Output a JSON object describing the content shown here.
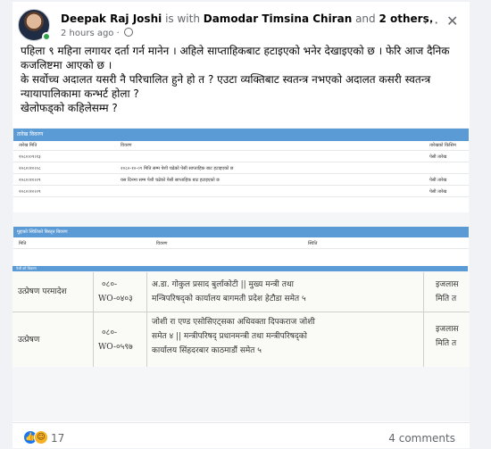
{
  "post": {
    "author": "Deepak Raj Joshi",
    "is_with_text": "is with",
    "tagged": "Damodar Timsina Chiran",
    "and_text": "and",
    "others": "2 others.",
    "time": "2 hours ago",
    "lines": [
      "पहिला ९ महिना लगायर दर्ता गर्न मानेन । अहिले साप्ताहिकबाट हटाइएको भनेर देखाइएको छ । फेरि आज दैनिक",
      "कजलिष्टमा आएको छ ।",
      "के सर्वोच्च अदालत यसरी नै परिचालित हुने हो त ? एउटा व्यक्तिबाट स्वतन्त्र नभएको अदालत कसरी स्वतन्त्र",
      "न्यायापालिकामा कन्भर्ट होला ?",
      "खेलोफड्को कहिलेसम्म ?"
    ]
  },
  "doc": {
    "section1_title": "तारेख विवरण",
    "headers1": [
      "तारेख मिति",
      "विवरण",
      "तारेखको किसिम"
    ],
    "rows1": [
      [
        "२०८०।०९।१३",
        "",
        "पेसी तारेख"
      ],
      [
        "२०८०।१०।०८",
        "२०८०-१०-०९ मिति सम्म पेशी चढेको पेसी साप्ताहिक बाट हटाइएको छ",
        ""
      ],
      [
        "२०८०।१०।०९",
        "यस दिनमा सम्म पेशी चढेको पेसी साप्ताहिक बाट हटाइएको छ",
        "पेसी तारेख"
      ],
      [
        "२०८०।१०।०९",
        "",
        "पेसी तारेख"
      ]
    ],
    "section2_title": "मुद्दाको स्थितिको बिस्तृत बिवरण",
    "headers2": [
      "मिति",
      "विवरण",
      "स्थिति"
    ],
    "section3_title": "पेशी को विवरण",
    "scan_rows": [
      {
        "type": "उत्प्रेषण परमादेश",
        "number": [
          "०८०-",
          "WO-०४०३"
        ],
        "desc": [
          "अ.डा. गोकुल प्रसाद बुर्लाकोटी  ||  मुख्य मन्त्री तथा",
          "मन्त्रिपरिषद्को कार्यालय बागमती प्रदेश हेटौडा समेत ५"
        ],
        "right": [
          "इजलास",
          "मिति त"
        ]
      },
      {
        "type": "उत्प्रेषण",
        "number": [
          "०८०-",
          "WO-०५९७"
        ],
        "desc": [
          "जोशी रा एण्ड एसोसिएट्सका अधिवक्ता दिपकराज जोशी",
          "समेत ४  ||  मन्त्रीपरिषद् प्रधानमन्त्री तथा मन्त्रीपरिषद्को",
          "कार्यालय सिंहदरबार काठमाडौं समेत ५"
        ],
        "right": [
          "इजलास",
          "मिति त"
        ]
      }
    ]
  },
  "footer": {
    "reaction_count": "17",
    "comments": "4 comments"
  },
  "colors": {
    "blue_header": "#5b9bd5",
    "facebook_blue": "#1877f2"
  }
}
